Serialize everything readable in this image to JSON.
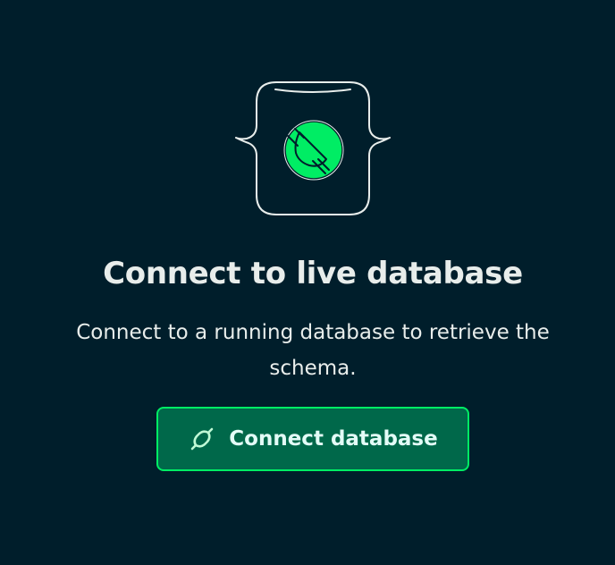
{
  "empty_state": {
    "illustration_icon": "plug-icon",
    "title": "Connect to live database",
    "description": "Connect to a running database to retrieve the schema.",
    "button": {
      "label": "Connect database",
      "icon": "connect-icon"
    }
  },
  "colors": {
    "background": "#001e2b",
    "accent": "#00ed64",
    "button_fill": "#00684a",
    "text": "#e8edeb"
  }
}
